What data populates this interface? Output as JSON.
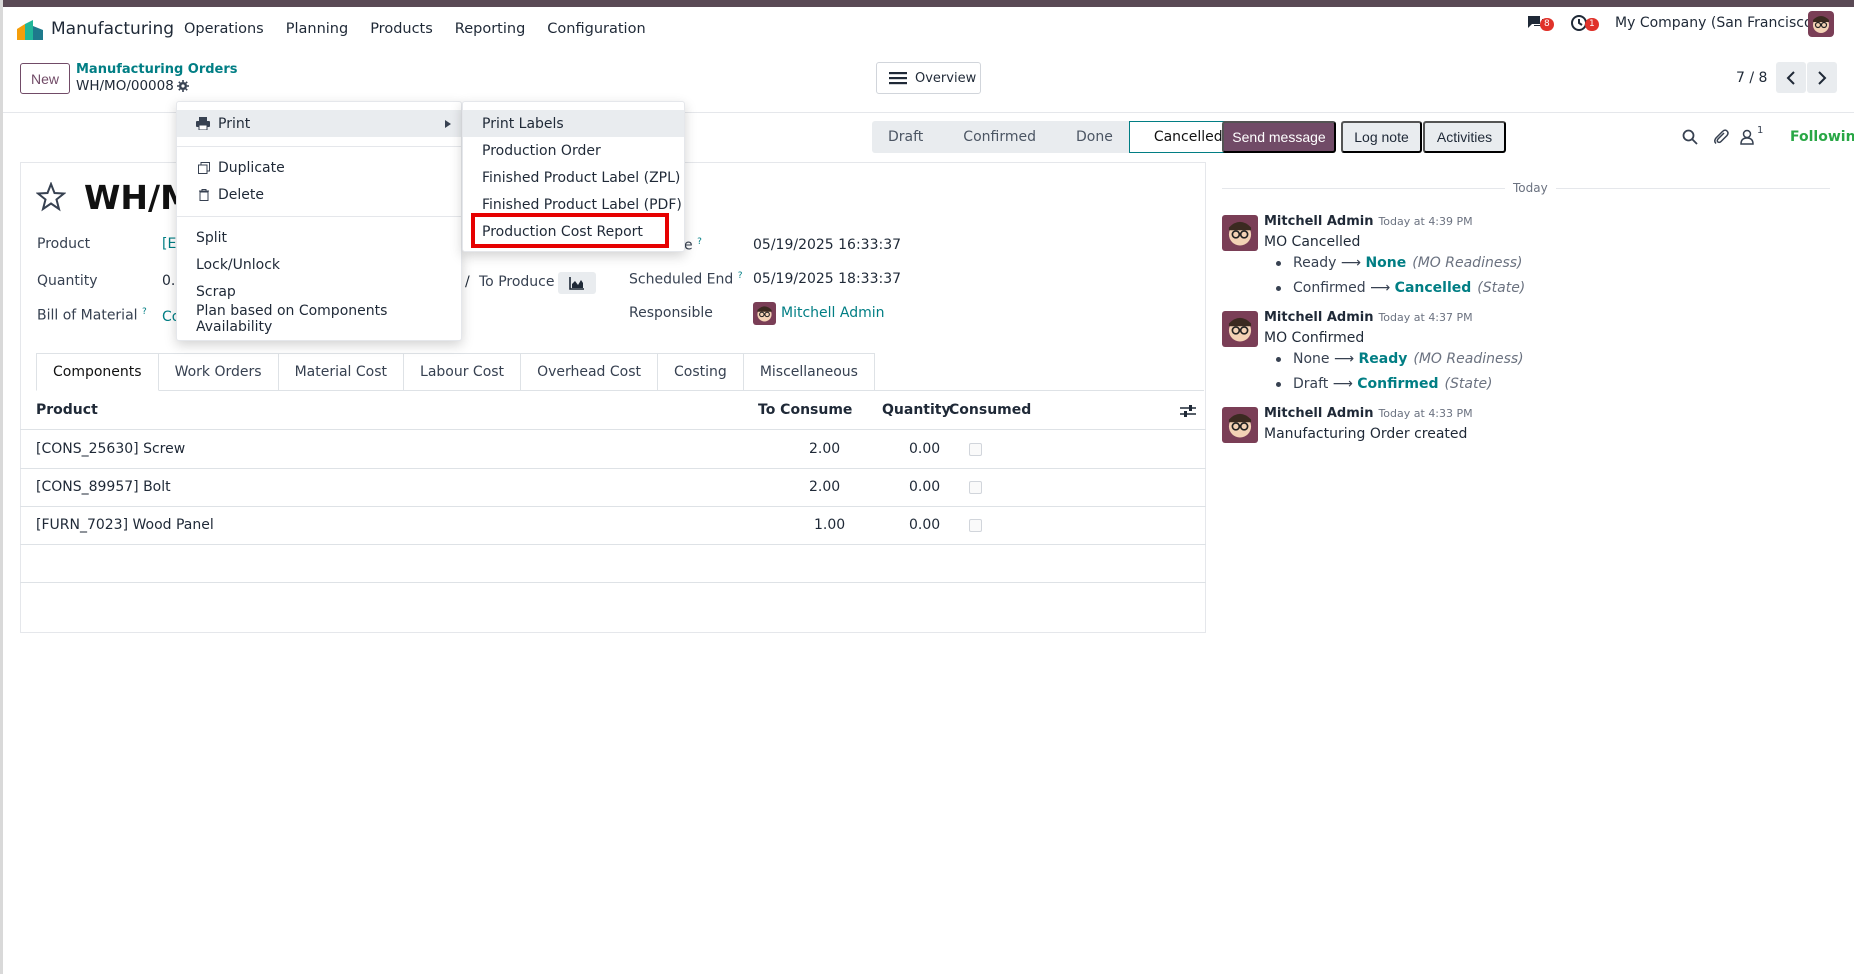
{
  "navbar": {
    "app_name": "Manufacturing",
    "menu": [
      "Operations",
      "Planning",
      "Products",
      "Reporting",
      "Configuration"
    ],
    "messages_badge": "8",
    "activities_badge": "1",
    "company": "My Company (San Francisco)"
  },
  "control": {
    "new_label": "New",
    "breadcrumb": "Manufacturing Orders",
    "record": "WH/MO/00008",
    "overview_label": "Overview",
    "pager": "7 / 8"
  },
  "status": {
    "stages": [
      "Draft",
      "Confirmed",
      "Done",
      "Cancelled"
    ],
    "active": "Cancelled"
  },
  "form": {
    "title": "WH/M",
    "product_label": "Product",
    "product_value": "[E",
    "quantity_label": "Quantity",
    "quantity_value": "0.",
    "to_produce_label": "To Produce",
    "to_produce_prefix": "/",
    "bom_label": "Bill of Material",
    "bom_value": "Co",
    "sched_start_label": "e",
    "sched_start_value": "05/19/2025 16:33:37",
    "sched_end_label": "Scheduled End",
    "sched_end_value": "05/19/2025 18:33:37",
    "responsible_label": "Responsible",
    "responsible_value": "Mitchell Admin",
    "help_mark": "?"
  },
  "tabs": [
    "Components",
    "Work Orders",
    "Material Cost",
    "Labour Cost",
    "Overhead Cost",
    "Costing",
    "Miscellaneous"
  ],
  "table": {
    "headers": [
      "Product",
      "To Consume",
      "Quantity",
      "Consumed"
    ],
    "rows": [
      {
        "product": "[CONS_25630] Screw",
        "to_consume": "2.00",
        "quantity": "0.00"
      },
      {
        "product": "[CONS_89957] Bolt",
        "to_consume": "2.00",
        "quantity": "0.00"
      },
      {
        "product": "[FURN_7023] Wood Panel",
        "to_consume": "1.00",
        "quantity": "0.00"
      }
    ]
  },
  "chatter": {
    "send_message": "Send message",
    "log_note": "Log note",
    "activities": "Activities",
    "followers_count": "1",
    "following": "Following",
    "today": "Today",
    "messages": [
      {
        "author": "Mitchell Admin",
        "time": "Today at 4:39 PM",
        "body": "MO Cancelled",
        "changes": [
          {
            "old": "Ready",
            "new": "None",
            "field": "(MO Readiness)"
          },
          {
            "old": "Confirmed",
            "new": "Cancelled",
            "field": "(State)"
          }
        ]
      },
      {
        "author": "Mitchell Admin",
        "time": "Today at 4:37 PM",
        "body": "MO Confirmed",
        "changes": [
          {
            "old": "None",
            "new": "Ready",
            "field": "(MO Readiness)"
          },
          {
            "old": "Draft",
            "new": "Confirmed",
            "field": "(State)"
          }
        ]
      },
      {
        "author": "Mitchell Admin",
        "time": "Today at 4:33 PM",
        "body": "Manufacturing Order created",
        "changes": []
      }
    ]
  },
  "gear_menu": {
    "print": "Print",
    "duplicate": "Duplicate",
    "delete": "Delete",
    "split": "Split",
    "lock_unlock": "Lock/Unlock",
    "scrap": "Scrap",
    "plan": "Plan based on Components Availability"
  },
  "print_submenu": [
    "Print Labels",
    "Production Order",
    "Finished Product Label (ZPL)",
    "Finished Product Label (PDF)",
    "Production Cost Report"
  ],
  "colors": {
    "brand": "#714b67",
    "link": "#017e84",
    "highlight": "#e60000",
    "following": "#28a745"
  }
}
